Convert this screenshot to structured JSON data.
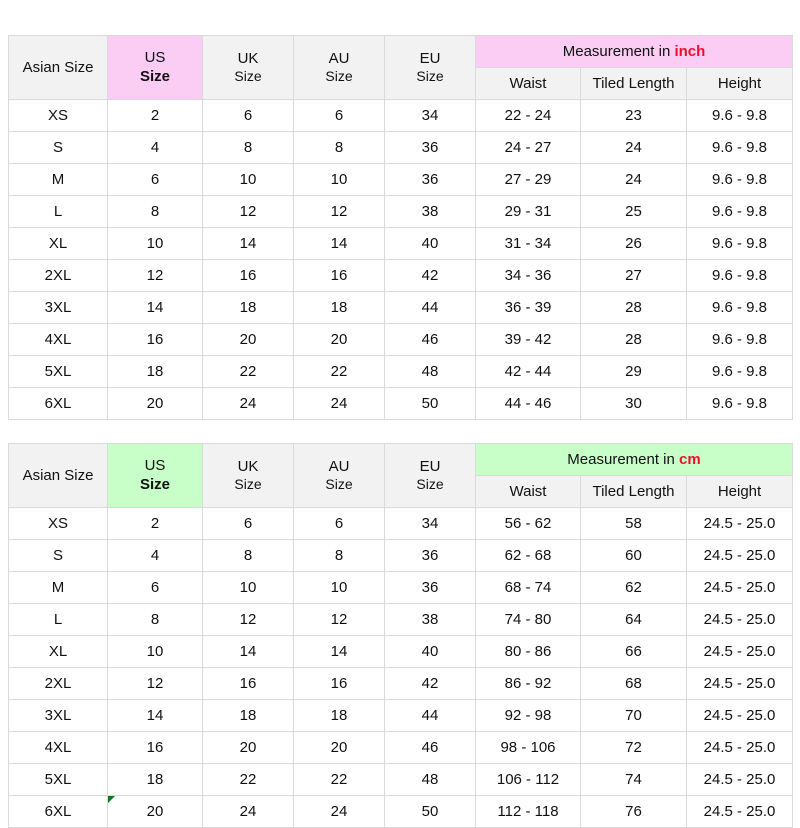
{
  "colors": {
    "accent_inch": "#fbcdf5",
    "accent_cm": "#c8ffc8",
    "header_band": "#f2f2f2",
    "unit_highlight": "#e8112d",
    "grid_line": "#d9d9d9",
    "comment_marker": "#0a7a20"
  },
  "common": {
    "headers": {
      "asian": "Asian Size",
      "us_line1": "US",
      "us_line2": "Size",
      "uk_line1": "UK",
      "uk_line2": "Size",
      "au_line1": "AU",
      "au_line2": "Size",
      "eu_line1": "EU",
      "eu_line2": "Size",
      "waist": "Waist",
      "tiled_length": "Tiled Length",
      "height": "Height"
    },
    "measurement_prefix": "Measurement in "
  },
  "tables": [
    {
      "id": "inch-table",
      "unit": "inch",
      "accent": "#fbcdf5",
      "rows": [
        {
          "asian": "XS",
          "us": "2",
          "uk": "6",
          "au": "6",
          "eu": "34",
          "waist": "22  -  24",
          "tiled": "23",
          "height": "9.6  -  9.8",
          "marker": false
        },
        {
          "asian": "S",
          "us": "4",
          "uk": "8",
          "au": "8",
          "eu": "36",
          "waist": "24  -  27",
          "tiled": "24",
          "height": "9.6  -  9.8",
          "marker": false
        },
        {
          "asian": "M",
          "us": "6",
          "uk": "10",
          "au": "10",
          "eu": "36",
          "waist": "27  -  29",
          "tiled": "24",
          "height": "9.6  -  9.8",
          "marker": false
        },
        {
          "asian": "L",
          "us": "8",
          "uk": "12",
          "au": "12",
          "eu": "38",
          "waist": "29  -  31",
          "tiled": "25",
          "height": "9.6  -  9.8",
          "marker": false
        },
        {
          "asian": "XL",
          "us": "10",
          "uk": "14",
          "au": "14",
          "eu": "40",
          "waist": "31  -  34",
          "tiled": "26",
          "height": "9.6  -  9.8",
          "marker": false
        },
        {
          "asian": "2XL",
          "us": "12",
          "uk": "16",
          "au": "16",
          "eu": "42",
          "waist": "34  -  36",
          "tiled": "27",
          "height": "9.6  -  9.8",
          "marker": false
        },
        {
          "asian": "3XL",
          "us": "14",
          "uk": "18",
          "au": "18",
          "eu": "44",
          "waist": "36  -  39",
          "tiled": "28",
          "height": "9.6  -  9.8",
          "marker": false
        },
        {
          "asian": "4XL",
          "us": "16",
          "uk": "20",
          "au": "20",
          "eu": "46",
          "waist": "39  -  42",
          "tiled": "28",
          "height": "9.6  -  9.8",
          "marker": false
        },
        {
          "asian": "5XL",
          "us": "18",
          "uk": "22",
          "au": "22",
          "eu": "48",
          "waist": "42  -  44",
          "tiled": "29",
          "height": "9.6  -  9.8",
          "marker": false
        },
        {
          "asian": "6XL",
          "us": "20",
          "uk": "24",
          "au": "24",
          "eu": "50",
          "waist": "44  -  46",
          "tiled": "30",
          "height": "9.6  -  9.8",
          "marker": false
        }
      ]
    },
    {
      "id": "cm-table",
      "unit": "cm",
      "accent": "#c8ffc8",
      "rows": [
        {
          "asian": "XS",
          "us": "2",
          "uk": "6",
          "au": "6",
          "eu": "34",
          "waist": "56  -  62",
          "tiled": "58",
          "height": "24.5  -  25.0",
          "marker": false
        },
        {
          "asian": "S",
          "us": "4",
          "uk": "8",
          "au": "8",
          "eu": "36",
          "waist": "62  -  68",
          "tiled": "60",
          "height": "24.5  -  25.0",
          "marker": false
        },
        {
          "asian": "M",
          "us": "6",
          "uk": "10",
          "au": "10",
          "eu": "36",
          "waist": "68  -  74",
          "tiled": "62",
          "height": "24.5  -  25.0",
          "marker": false
        },
        {
          "asian": "L",
          "us": "8",
          "uk": "12",
          "au": "12",
          "eu": "38",
          "waist": "74  -  80",
          "tiled": "64",
          "height": "24.5  -  25.0",
          "marker": false
        },
        {
          "asian": "XL",
          "us": "10",
          "uk": "14",
          "au": "14",
          "eu": "40",
          "waist": "80  -  86",
          "tiled": "66",
          "height": "24.5  -  25.0",
          "marker": false
        },
        {
          "asian": "2XL",
          "us": "12",
          "uk": "16",
          "au": "16",
          "eu": "42",
          "waist": "86  -  92",
          "tiled": "68",
          "height": "24.5  -  25.0",
          "marker": false
        },
        {
          "asian": "3XL",
          "us": "14",
          "uk": "18",
          "au": "18",
          "eu": "44",
          "waist": "92  -  98",
          "tiled": "70",
          "height": "24.5  -  25.0",
          "marker": false
        },
        {
          "asian": "4XL",
          "us": "16",
          "uk": "20",
          "au": "20",
          "eu": "46",
          "waist": "98  -  106",
          "tiled": "72",
          "height": "24.5  -  25.0",
          "marker": false
        },
        {
          "asian": "5XL",
          "us": "18",
          "uk": "22",
          "au": "22",
          "eu": "48",
          "waist": "106  -  112",
          "tiled": "74",
          "height": "24.5  -  25.0",
          "marker": false
        },
        {
          "asian": "6XL",
          "us": "20",
          "uk": "24",
          "au": "24",
          "eu": "50",
          "waist": "112  -  118",
          "tiled": "76",
          "height": "24.5  -  25.0",
          "marker": true
        }
      ]
    }
  ]
}
